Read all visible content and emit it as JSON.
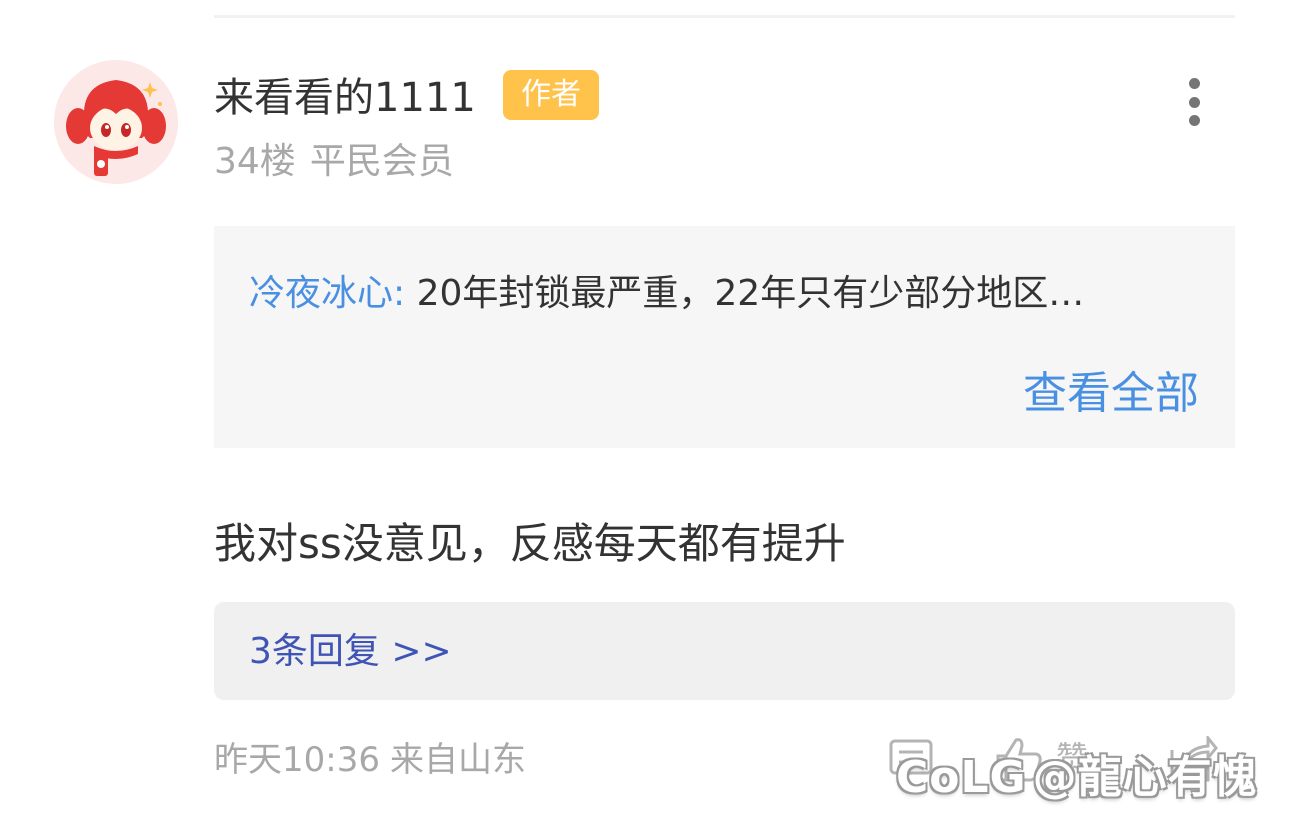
{
  "post": {
    "author": "来看看的1111",
    "author_badge": "作者",
    "floor": "34楼",
    "member_level": "平民会员",
    "quote": {
      "author": "冷夜冰心:",
      "text": "20年封锁最严重，22年只有少部分地区…",
      "view_all": "查看全部"
    },
    "body": "我对ss没意见，反感每天都有提升",
    "replies_link": "3条回复 >>",
    "time": "昨天10:36",
    "location": "来自山东",
    "like_label": "赞"
  },
  "watermark": {
    "brand": "CoLG",
    "handle": "@龍心有愧"
  },
  "colors": {
    "accent_blue": "#4a90e2",
    "reply_link_blue": "#3f55b5",
    "badge_orange": "#ffc24a",
    "meta_gray": "#a8a8a8",
    "quote_bg": "#f6f6f6",
    "avatar_red": "#e53935"
  },
  "icons": [
    "more-vertical-icon",
    "comment-icon",
    "thumbs-up-icon",
    "share-icon"
  ]
}
